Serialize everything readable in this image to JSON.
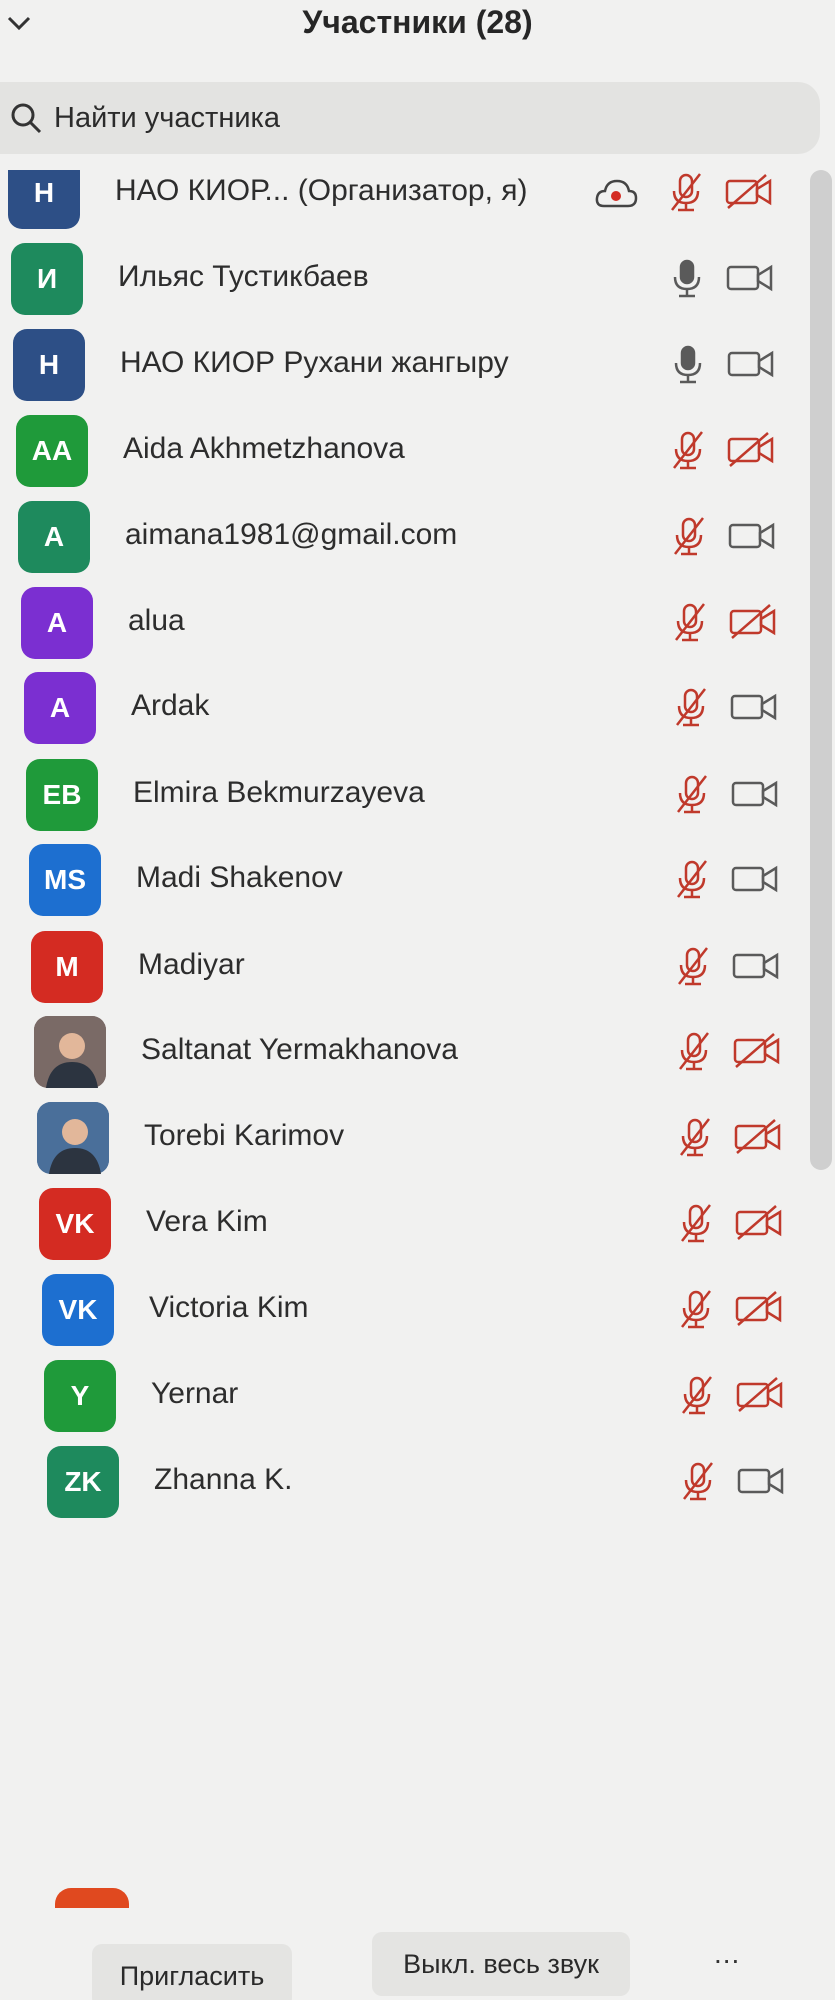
{
  "header": {
    "title": "Участники (28)",
    "collapse_icon": "chevron-down-icon"
  },
  "search": {
    "placeholder": "Найти участника",
    "icon": "search-icon"
  },
  "participants": [
    {
      "initials": "Н",
      "name": "НАО КИОР... (Организатор, я)",
      "avatar_color": "#2d4f86",
      "mic": "muted",
      "camera": "off",
      "recording": true
    },
    {
      "initials": "И",
      "name": "Ильяс Тустикбаев",
      "avatar_color": "#1e8a5d",
      "mic": "on",
      "camera": "on"
    },
    {
      "initials": "Н",
      "name": "НАО КИОР Рухани жангыру",
      "avatar_color": "#2d4f86",
      "mic": "on",
      "camera": "on"
    },
    {
      "initials": "AA",
      "name": "Aida Akhmetzhanova",
      "avatar_color": "#1f9a3a",
      "mic": "muted",
      "camera": "off"
    },
    {
      "initials": "A",
      "name": "aimana1981@gmail.com",
      "avatar_color": "#1e8a5d",
      "mic": "muted",
      "camera": "on"
    },
    {
      "initials": "A",
      "name": "alua",
      "avatar_color": "#7b2fd1",
      "mic": "muted",
      "camera": "off"
    },
    {
      "initials": "A",
      "name": "Ardak",
      "avatar_color": "#7b2fd1",
      "mic": "muted",
      "camera": "on"
    },
    {
      "initials": "EB",
      "name": "Elmira Bekmurzayeva",
      "avatar_color": "#1f9a3a",
      "mic": "muted",
      "camera": "on"
    },
    {
      "initials": "MS",
      "name": "Madi Shakenov",
      "avatar_color": "#1d6fd0",
      "mic": "muted",
      "camera": "on"
    },
    {
      "initials": "M",
      "name": "Madiyar",
      "avatar_color": "#d42b22",
      "mic": "muted",
      "camera": "on"
    },
    {
      "initials": "",
      "name": "Saltanat  Yermakhanova",
      "avatar_color": "#7a6a66",
      "photo": true,
      "mic": "muted",
      "camera": "off"
    },
    {
      "initials": "",
      "name": "Torebi Karimov",
      "avatar_color": "#4a6f9a",
      "photo": true,
      "mic": "muted",
      "camera": "off"
    },
    {
      "initials": "VK",
      "name": "Vera Kim",
      "avatar_color": "#d42b22",
      "mic": "muted",
      "camera": "off"
    },
    {
      "initials": "VK",
      "name": "Victoria Kim",
      "avatar_color": "#1d6fd0",
      "mic": "muted",
      "camera": "off"
    },
    {
      "initials": "Y",
      "name": "Yernar",
      "avatar_color": "#1f9a3a",
      "mic": "muted",
      "camera": "off"
    },
    {
      "initials": "ZK",
      "name": "Zhanna K.",
      "avatar_color": "#1e8a5d",
      "mic": "muted",
      "camera": "on"
    }
  ],
  "footer": {
    "invite_label": "Пригласить",
    "mute_all_label": "Выкл. весь звук",
    "more_label": "..."
  },
  "colors": {
    "muted_red": "#c0392b",
    "icon_gray": "#5a5a5a"
  }
}
